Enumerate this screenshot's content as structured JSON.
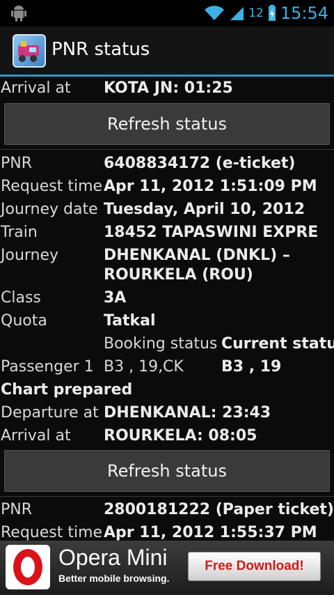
{
  "status_bar": {
    "battery": "12",
    "time": "15:54"
  },
  "app": {
    "title": "PNR status",
    "icon": "train-icon"
  },
  "top_entry": {
    "arrival_label": "Arrival at",
    "arrival_value": "KOTA JN: 01:25",
    "refresh_label": "Refresh status"
  },
  "entry1": {
    "pnr_label": "PNR",
    "pnr_value": "6408834172 (e-ticket)",
    "request_label": "Request time",
    "request_value": "Apr 11, 2012 1:51:09 PM",
    "journey_date_label": "Journey date",
    "journey_date_value": "Tuesday, April 10, 2012",
    "train_label": "Train",
    "train_value": "18452 TAPASWINI EXPRE",
    "journey_label": "Journey",
    "journey_value_1": "DHENKANAL (DNKL) –",
    "journey_value_2": "ROURKELA (ROU)",
    "class_label": "Class",
    "class_value": "3A",
    "quota_label": "Quota",
    "quota_value": "Tatkal",
    "booking_status_header": "Booking status",
    "current_status_header": "Current status",
    "passenger_label": "Passenger 1",
    "passenger_booking": "B3  , 19,CK",
    "passenger_current": "B3  , 19",
    "chart_status": "Chart prepared",
    "departure_label": "Departure at",
    "departure_value": "DHENKANAL: 23:43",
    "arrival_label": "Arrival at",
    "arrival_value": "ROURKELA: 08:05",
    "refresh_label": "Refresh status"
  },
  "entry2": {
    "pnr_label": "PNR",
    "pnr_value": "2800181222 (Paper ticket)",
    "request_label": "Request time",
    "request_value": "Apr 11, 2012 1:55:37 PM"
  },
  "ad": {
    "name": "Opera Mini",
    "tagline": "Better mobile browsing.",
    "button": "Free Download!"
  }
}
